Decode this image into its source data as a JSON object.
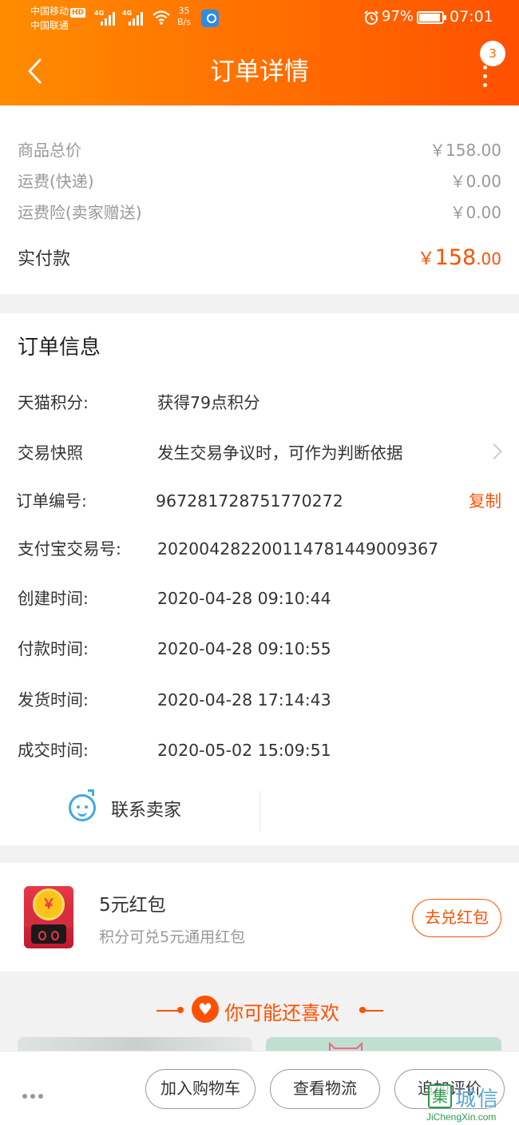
{
  "status_bar": {
    "carrier1": "中国移动",
    "hd": "HD",
    "carrier2": "中国联通",
    "net1": "4G",
    "net2": "4G",
    "speed_value": "35",
    "speed_unit": "B/s",
    "battery_pct": "97%",
    "time": "07:01"
  },
  "header": {
    "title": "订单详情",
    "badge_count": "3"
  },
  "price": {
    "goods_total_label": "商品总价",
    "goods_total_value": "￥158.00",
    "shipping_label": "运费(快递)",
    "shipping_value": "￥0.00",
    "insurance_label": "运费险(卖家赠送)",
    "insurance_value": "￥0.00",
    "paid_label": "实付款",
    "paid_currency": "￥",
    "paid_int": "158",
    "paid_dec": ".00"
  },
  "order_info": {
    "title": "订单信息",
    "rows": [
      {
        "key": "天猫积分:",
        "value": "获得79点积分"
      },
      {
        "key": "交易快照",
        "value": "发生交易争议时，可作为判断依据"
      },
      {
        "key": "订单编号:",
        "value": "967281728751770272"
      },
      {
        "key": "支付宝交易号:",
        "value": "2020042822001147814490093​67"
      },
      {
        "key": "创建时间:",
        "value": "2020-04-28 09:10:44"
      },
      {
        "key": "付款时间:",
        "value": "2020-04-28 09:10:55"
      },
      {
        "key": "发货时间:",
        "value": "2020-04-28 17:14:43"
      },
      {
        "key": "成交时间:",
        "value": "2020-05-02 15:09:51"
      }
    ],
    "copy_label": "复制",
    "contact_label": "联系卖家"
  },
  "red_packet": {
    "coin_symbol": "￥",
    "title": "5元红包",
    "subtitle": "积分可兑5元通用红包",
    "button": "去兑红包"
  },
  "recommend": {
    "title": "你可能还喜欢"
  },
  "bottom_bar": {
    "add_cart": "加入购物车",
    "logistics": "查看物流",
    "review": "追加评价"
  },
  "watermark": {
    "square": "集",
    "cn": "城信",
    "en": "JiChengXin.com"
  },
  "colors": {
    "accent": "#ff5000",
    "header_start": "#ff8c00",
    "header_end": "#ff5000",
    "contact_icon": "#3ea9e8"
  }
}
